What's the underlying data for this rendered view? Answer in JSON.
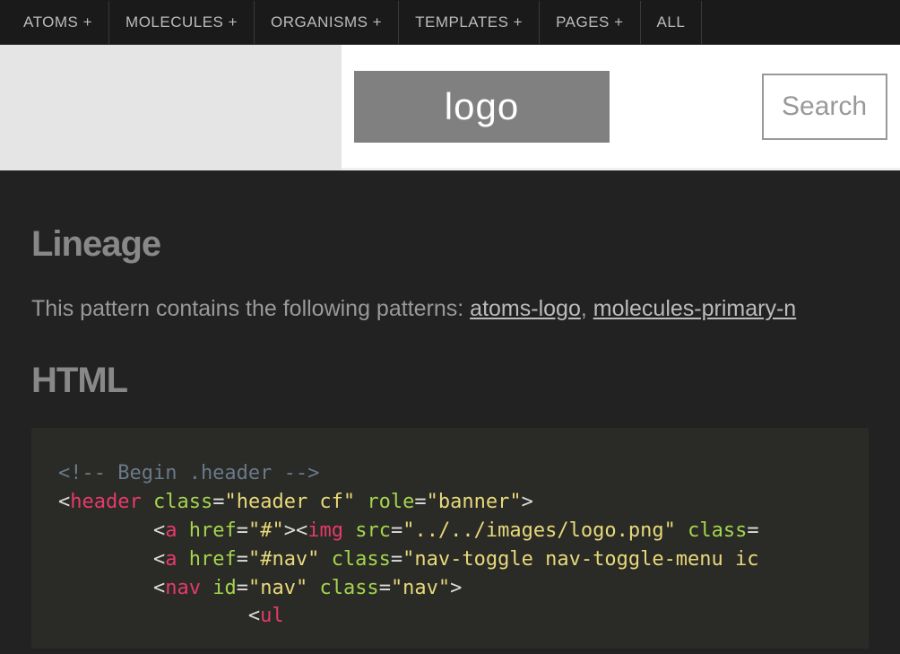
{
  "nav": {
    "items": [
      "ATOMS +",
      "MOLECULES +",
      "ORGANISMS +",
      "TEMPLATES +",
      "PAGES +",
      "ALL"
    ]
  },
  "preview": {
    "logo_label": "logo",
    "search_placeholder": "Search"
  },
  "panel": {
    "lineage_heading": "Lineage",
    "lineage_prefix": "This pattern contains the following patterns: ",
    "lineage_link1": "atoms-logo",
    "lineage_sep": ", ",
    "lineage_link2": "molecules-primary-n",
    "html_heading": "HTML"
  },
  "code": {
    "l1_comment": "<!-- Begin .header -->",
    "l2_tag_open": "<",
    "l2_tag": "header",
    "l2_sp": " ",
    "l2_attr1": "class",
    "l2_eq": "=",
    "l2_val1": "\"header cf\"",
    "l2_attr2": "role",
    "l2_val2": "\"banner\"",
    "l2_close": ">",
    "l3_tag_open": "<",
    "l3_tag1": "a",
    "l3_attr1": "href",
    "l3_val1": "\"#\"",
    "l3_close1": ">",
    "l3_tag2": "img",
    "l3_attr2": "src",
    "l3_val2": "\"../../images/logo.png\"",
    "l3_attr3": "class",
    "l4_tag1": "a",
    "l4_attr1": "href",
    "l4_val1": "\"#nav\"",
    "l4_attr2": "class",
    "l4_val2": "\"nav-toggle nav-toggle-menu ic",
    "l5_tag1": "nav",
    "l5_attr1": "id",
    "l5_val1": "\"nav\"",
    "l5_attr2": "class",
    "l5_val2": "\"nav\"",
    "l5_close": ">",
    "l6_tag": "ul"
  }
}
